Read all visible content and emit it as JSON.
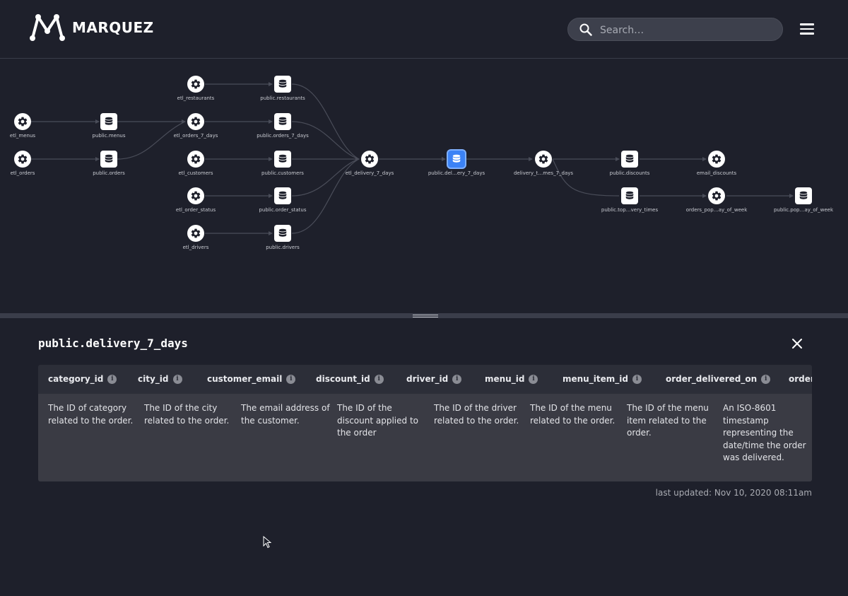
{
  "header": {
    "brand": "MARQUEZ",
    "search_placeholder": "Search…"
  },
  "graph": {
    "nodes": [
      {
        "id": "etl_restaurants",
        "label": "etl_restaurants",
        "kind": "job"
      },
      {
        "id": "public_restaurants",
        "label": "public.restaurants",
        "kind": "dataset"
      },
      {
        "id": "etl_menus",
        "label": "etl_menus",
        "kind": "job"
      },
      {
        "id": "public_menus",
        "label": "public.menus",
        "kind": "dataset"
      },
      {
        "id": "etl_orders_7_days",
        "label": "etl_orders_7_days",
        "kind": "job"
      },
      {
        "id": "public_orders_7_days",
        "label": "public.orders_7_days",
        "kind": "dataset"
      },
      {
        "id": "etl_orders",
        "label": "etl_orders",
        "kind": "job"
      },
      {
        "id": "public_orders",
        "label": "public.orders",
        "kind": "dataset"
      },
      {
        "id": "etl_customers",
        "label": "etl_customers",
        "kind": "job"
      },
      {
        "id": "public_customers",
        "label": "public.customers",
        "kind": "dataset"
      },
      {
        "id": "etl_delivery_7_days",
        "label": "etl_delivery_7_days",
        "kind": "job"
      },
      {
        "id": "public_delivery_7_days",
        "label": "public.del…ery_7_days",
        "kind": "dataset",
        "selected": true
      },
      {
        "id": "delivery_times_7_days",
        "label": "delivery_t…mes_7_days",
        "kind": "job"
      },
      {
        "id": "public_discounts",
        "label": "public.discounts",
        "kind": "dataset"
      },
      {
        "id": "email_discounts",
        "label": "email_discounts",
        "kind": "job"
      },
      {
        "id": "etl_order_status",
        "label": "etl_order_status",
        "kind": "job"
      },
      {
        "id": "public_order_status",
        "label": "public.order_status",
        "kind": "dataset"
      },
      {
        "id": "public_top_delivery_times",
        "label": "public.top…very_times",
        "kind": "dataset"
      },
      {
        "id": "orders_popular_day_of_week",
        "label": "orders_pop…ay_of_week",
        "kind": "job"
      },
      {
        "id": "public_popular_day_of_week",
        "label": "public.pop…ay_of_week",
        "kind": "dataset"
      },
      {
        "id": "etl_drivers",
        "label": "etl_drivers",
        "kind": "job"
      },
      {
        "id": "public_drivers",
        "label": "public.drivers",
        "kind": "dataset"
      }
    ]
  },
  "detail": {
    "title": "public.delivery_7_days",
    "columns": [
      {
        "name": "category_id",
        "description": "The ID of category related to the order."
      },
      {
        "name": "city_id",
        "description": "The ID of the city related to the order."
      },
      {
        "name": "customer_email",
        "description": "The email address of the customer."
      },
      {
        "name": "discount_id",
        "description": "The ID of the discount applied to the order"
      },
      {
        "name": "driver_id",
        "description": "The ID of the driver related to the order."
      },
      {
        "name": "menu_id",
        "description": "The ID of the menu related to the order."
      },
      {
        "name": "menu_item_id",
        "description": "The ID of the menu item related to the order."
      },
      {
        "name": "order_delivered_on",
        "description": "An ISO-8601 timestamp representing the date/time the order was delivered."
      },
      {
        "name": "order_",
        "description": ""
      }
    ],
    "info_glyph": "i",
    "last_updated": "last updated: Nov 10, 2020 08:11am"
  },
  "colors": {
    "background": "#1e202b",
    "selected_node": "#3b82f6",
    "table_header": "#2c2e38",
    "table_body": "#3a3b44"
  }
}
